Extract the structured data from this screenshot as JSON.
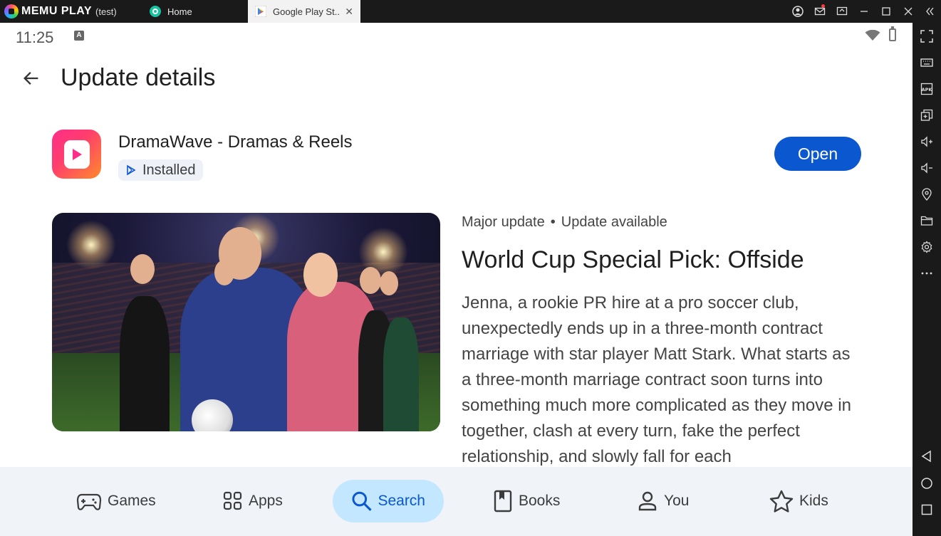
{
  "window": {
    "brand": "MEMU PLAY",
    "instance": "(test)",
    "tabs": [
      {
        "label": "Home"
      },
      {
        "label": "Google Play St.."
      }
    ]
  },
  "status": {
    "time": "11:25",
    "keyboard_badge": "A"
  },
  "header": {
    "title": "Update details"
  },
  "app": {
    "name": "DramaWave - Dramas & Reels",
    "status_chip": "Installed",
    "open_button": "Open"
  },
  "update": {
    "meta_type": "Major update",
    "meta_separator": "•",
    "meta_status": "Update available",
    "title": "World Cup Special Pick: Offside",
    "description": "Jenna, a rookie PR hire at a pro soccer club, unexpectedly ends up in a three-month contract marriage with star player Matt Stark. What starts as a three-month marriage contract soon turns into something much more complicated as they move in together, clash at every turn, fake the perfect relationship, and slowly fall for each"
  },
  "bottom_nav": {
    "items": [
      {
        "label": "Games",
        "icon": "gamepad-icon"
      },
      {
        "label": "Apps",
        "icon": "apps-grid-icon"
      },
      {
        "label": "Search",
        "icon": "search-icon",
        "active": true
      },
      {
        "label": "Books",
        "icon": "book-icon"
      },
      {
        "label": "You",
        "icon": "person-icon"
      },
      {
        "label": "Kids",
        "icon": "star-icon"
      }
    ]
  },
  "colors": {
    "accent": "#0b57d0",
    "active_pill": "#c2e7ff",
    "nav_bg": "#f0f4f9",
    "frame": "#1a1a1a"
  }
}
